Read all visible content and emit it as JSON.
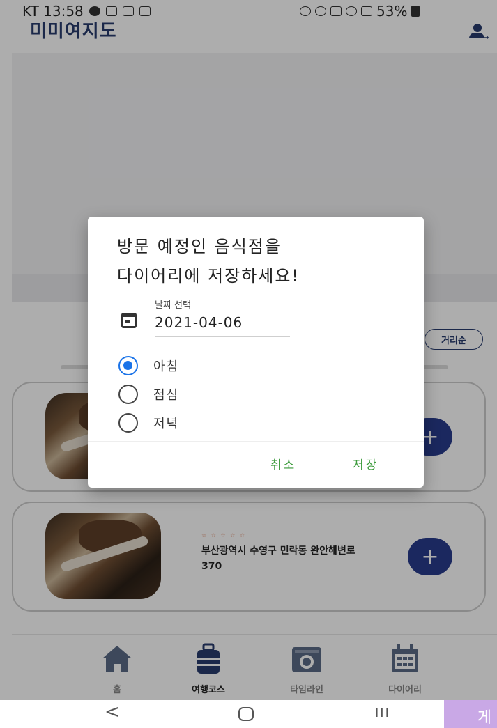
{
  "status_bar": {
    "left_text": "KT 13:58",
    "right_text": "53%"
  },
  "app": {
    "title": "미미여지도",
    "sort_chip": "거리순",
    "cards": [
      {
        "stars": "",
        "address": ""
      },
      {
        "stars": "☆ ☆ ☆ ☆ ☆",
        "address": "부산광역시 수영구 민락동 완안해변로 370"
      }
    ],
    "bottom_nav": [
      {
        "label": "홈",
        "icon": "home-icon"
      },
      {
        "label": "여행코스",
        "icon": "luggage-icon"
      },
      {
        "label": "타임라인",
        "icon": "camera-icon"
      },
      {
        "label": "다이어리",
        "icon": "calendar-icon"
      }
    ],
    "plus_label": "+"
  },
  "dialog": {
    "title_line1": "방문 예정인 음식점을",
    "title_line2": "다이어리에 저장하세요!",
    "date_label": "날짜 선택",
    "date_value": "2021-04-06",
    "meal_options": [
      {
        "label": "아침",
        "selected": true
      },
      {
        "label": "점심",
        "selected": false
      },
      {
        "label": "저녁",
        "selected": false
      }
    ],
    "cancel_label": "취소",
    "save_label": "저장"
  },
  "system_nav": {
    "back": "<",
    "recent": "III",
    "ime_label": "게"
  },
  "colors": {
    "brand": "#283c6e",
    "fab": "#283c8c",
    "radio_checked": "#1a73e8",
    "dialog_button": "#3a9a3a"
  }
}
